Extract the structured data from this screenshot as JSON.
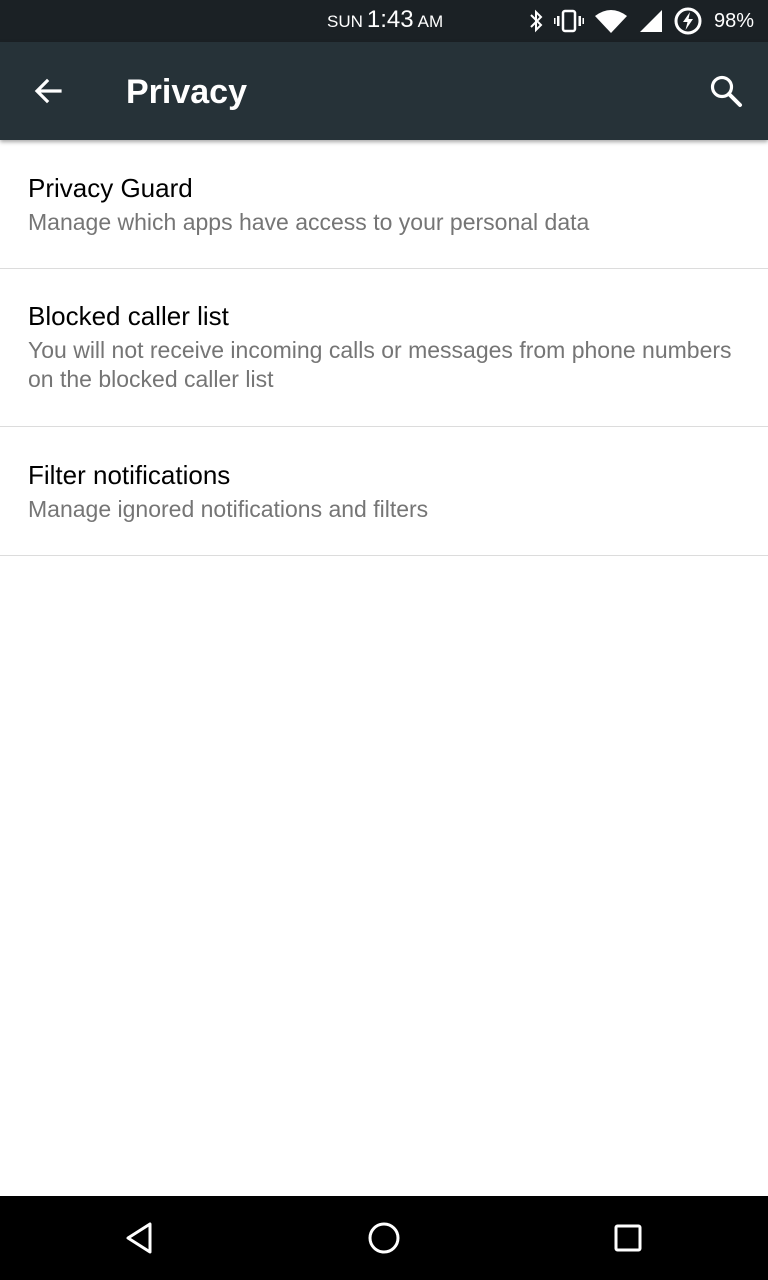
{
  "status_bar": {
    "day": "SUN",
    "time": "1:43",
    "ampm": "AM",
    "battery_percent": "98%",
    "icons": [
      "bluetooth-icon",
      "vibrate-icon",
      "wifi-icon",
      "signal-icon",
      "battery-charging-icon"
    ]
  },
  "app_bar": {
    "title": "Privacy",
    "back_icon": "arrow-back-icon",
    "search_icon": "search-icon",
    "background_color": "#263238"
  },
  "settings": {
    "items": [
      {
        "title": "Privacy Guard",
        "summary": "Manage which apps have access to your personal data"
      },
      {
        "title": "Blocked caller list",
        "summary": "You will not receive incoming calls or messages from phone numbers on the blocked caller list"
      },
      {
        "title": "Filter notifications",
        "summary": "Manage ignored notifications and filters"
      }
    ]
  },
  "nav_bar": {
    "buttons": [
      "nav-back-icon",
      "nav-home-icon",
      "nav-recents-icon"
    ]
  }
}
